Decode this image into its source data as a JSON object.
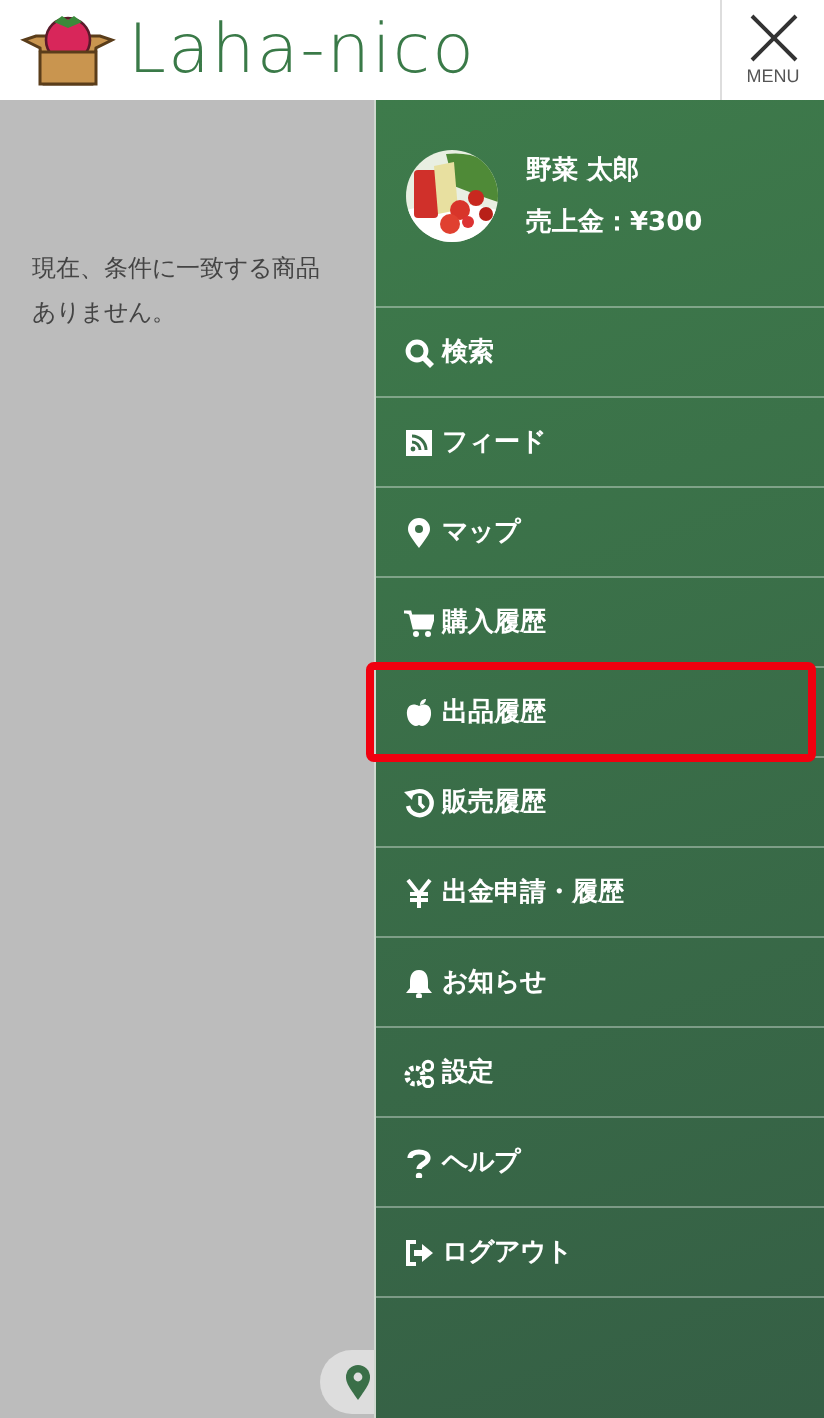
{
  "header": {
    "logo_text": "Laha-nico",
    "menu_label": "MENU"
  },
  "content": {
    "message_lines": [
      "現在、条件に一致する商品",
      "ありません。"
    ]
  },
  "drawer": {
    "user": {
      "name": "野菜 太郎",
      "sales": "売上金：¥300"
    },
    "items": [
      {
        "label": "検索",
        "highlighted": false
      },
      {
        "label": "フィード",
        "highlighted": false
      },
      {
        "label": "マップ",
        "highlighted": false
      },
      {
        "label": "購入履歴",
        "highlighted": false
      },
      {
        "label": "出品履歴",
        "highlighted": true
      },
      {
        "label": "販売履歴",
        "highlighted": false
      },
      {
        "label": "出金申請・履歴",
        "highlighted": false
      },
      {
        "label": "お知らせ",
        "highlighted": false
      },
      {
        "label": "設定",
        "highlighted": false
      },
      {
        "label": "ヘルプ",
        "highlighted": false
      },
      {
        "label": "ログアウト",
        "highlighted": false
      }
    ]
  }
}
